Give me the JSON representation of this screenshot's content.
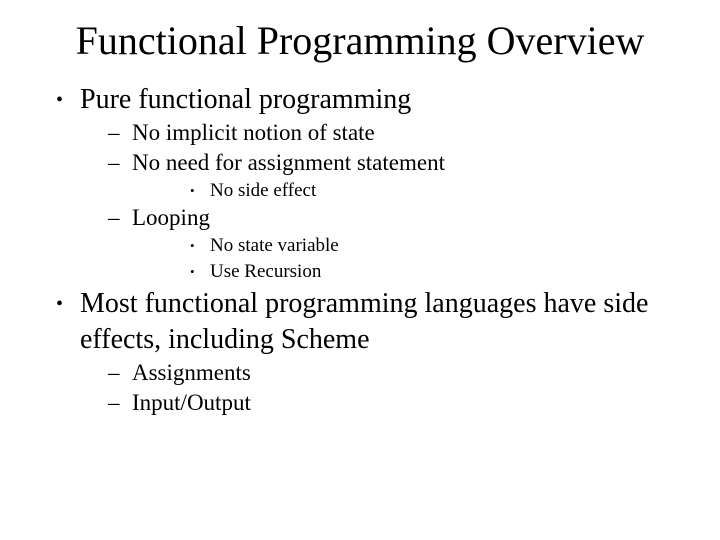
{
  "title": "Functional Programming Overview",
  "b1": "Pure functional programming",
  "b1_1": "No implicit notion of state",
  "b1_2": "No need for assignment statement",
  "b1_2_1": "No side effect",
  "b1_3": "Looping",
  "b1_3_1": "No state variable",
  "b1_3_2": "Use Recursion",
  "b2": "Most functional programming languages have side effects, including Scheme",
  "b2_1": "Assignments",
  "b2_2": "Input/Output"
}
